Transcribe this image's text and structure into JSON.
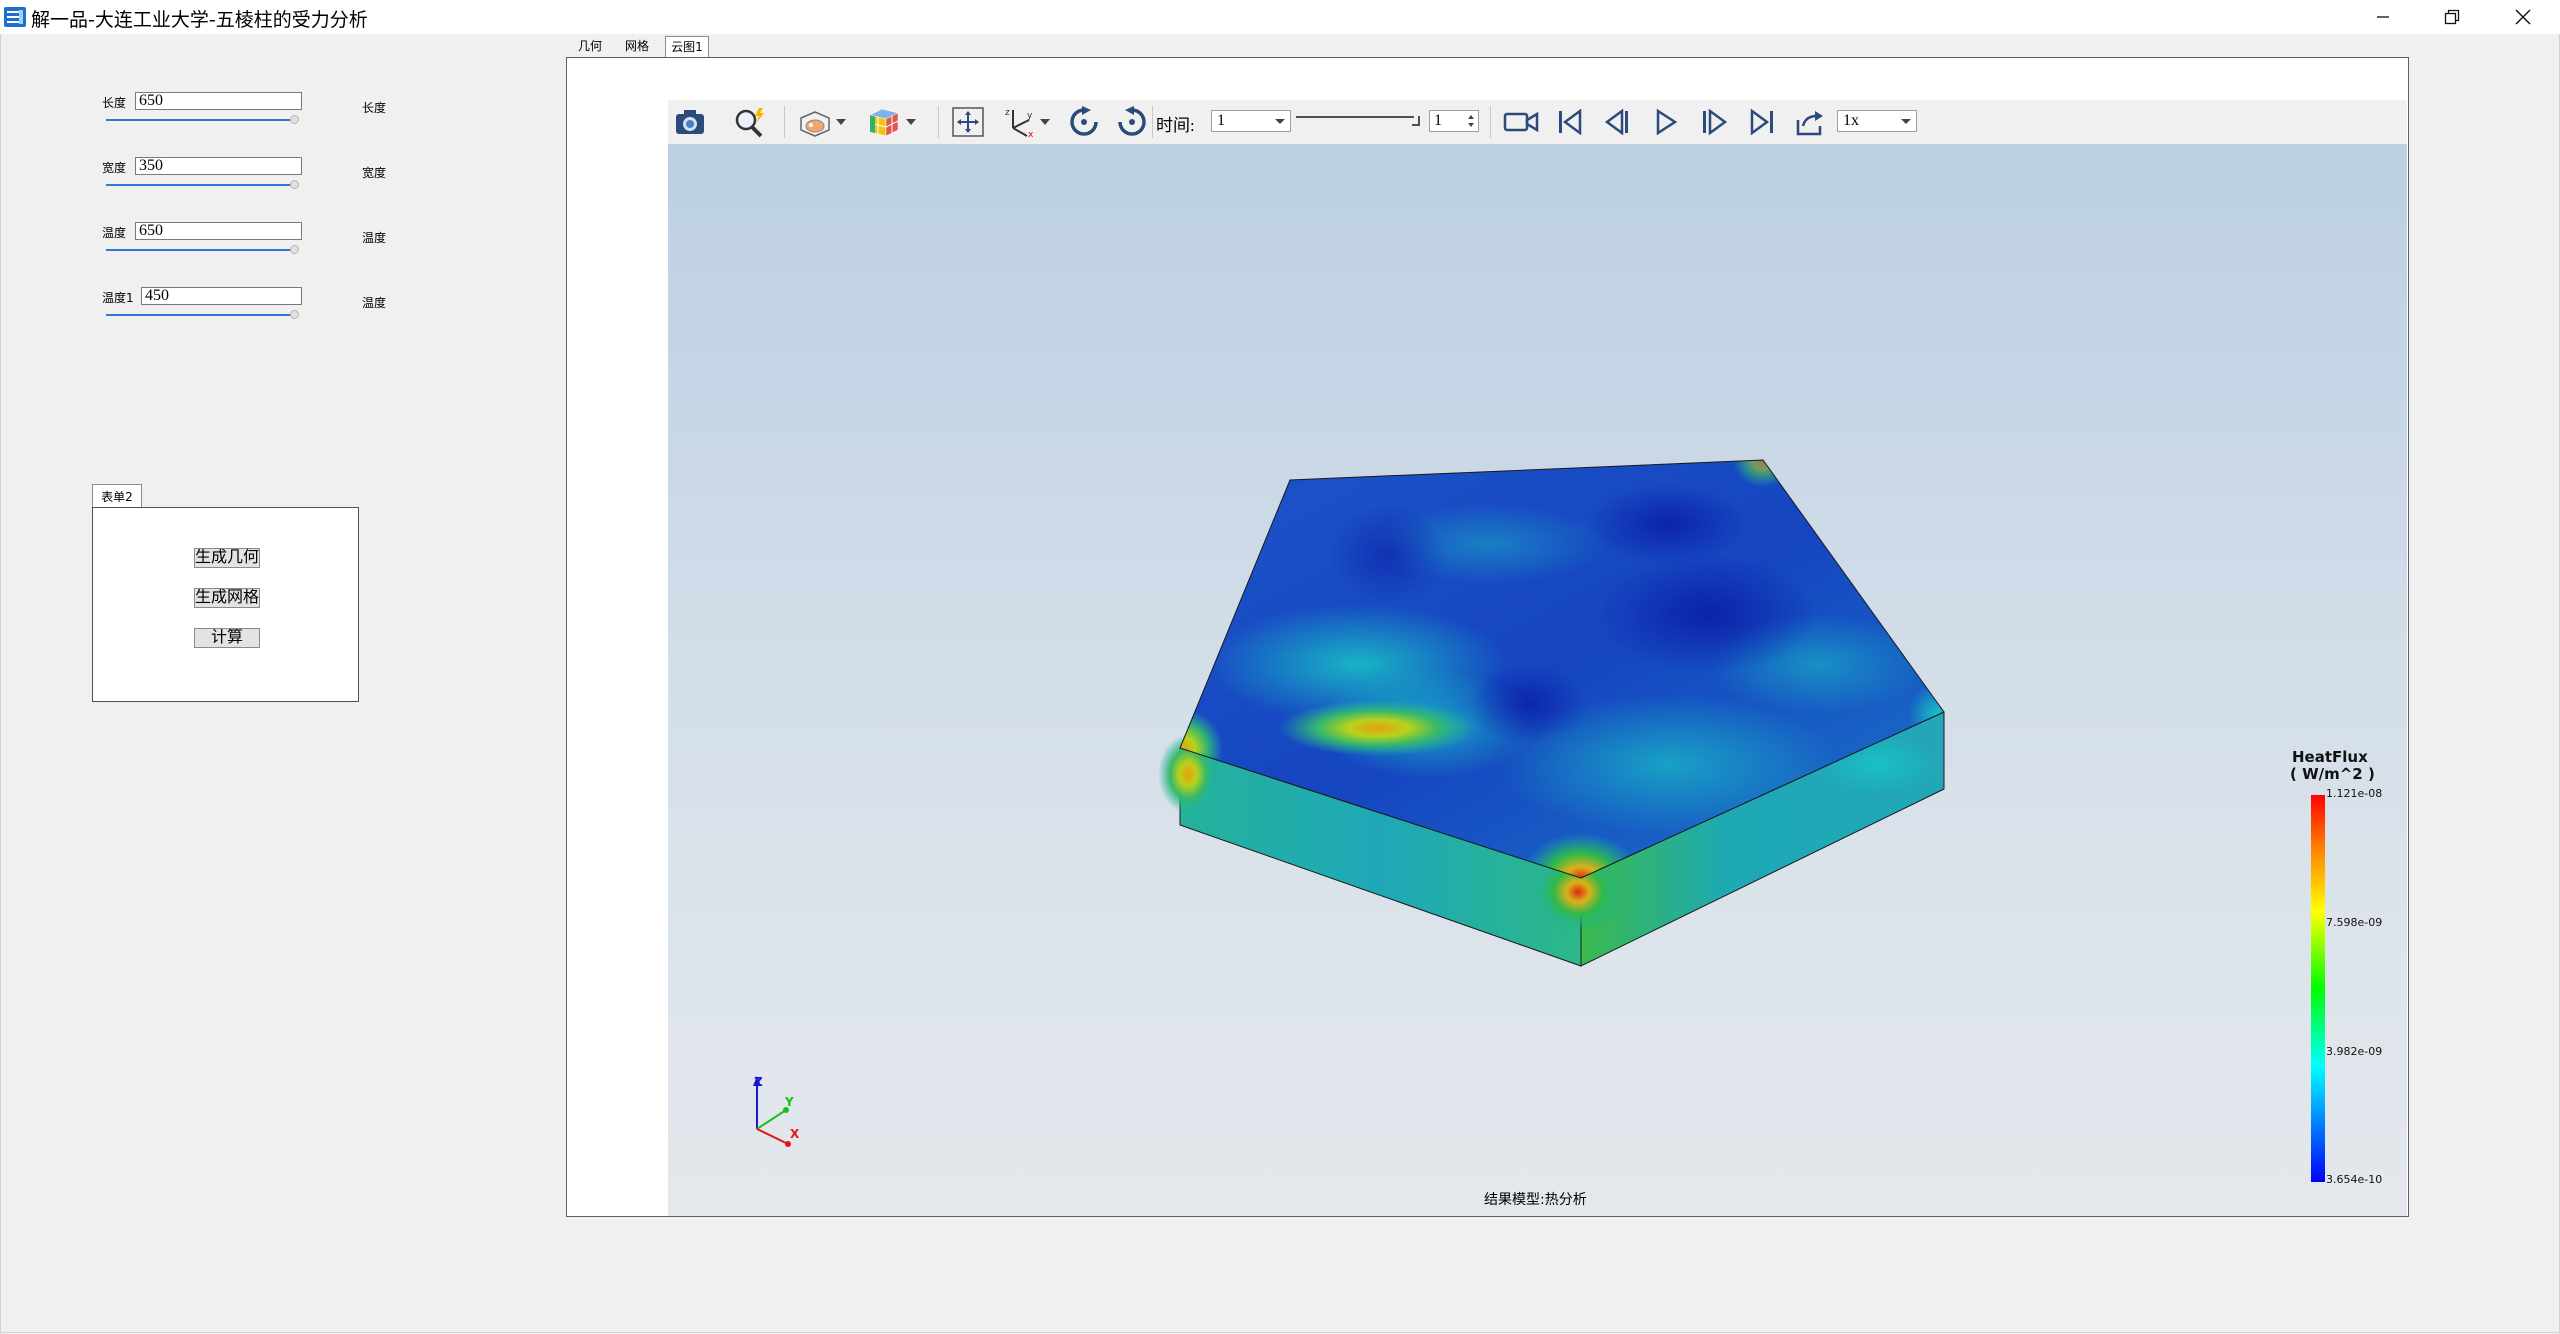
{
  "window": {
    "title": "解一品-大连工业大学-五棱柱的受力分析",
    "icons": [
      "app-icon",
      "minimize-icon",
      "restore-icon",
      "close-icon"
    ]
  },
  "parameters": [
    {
      "label": "长度",
      "value": "650",
      "unit": "长度",
      "slider_fraction": 1.0
    },
    {
      "label": "宽度",
      "value": "350",
      "unit": "宽度",
      "slider_fraction": 1.0
    },
    {
      "label": "温度",
      "value": "650",
      "unit": "温度",
      "slider_fraction": 1.0
    },
    {
      "label": "温度1",
      "value": "450",
      "unit": "温度",
      "slider_fraction": 1.0
    }
  ],
  "form": {
    "tab": "表单2",
    "buttons": [
      "生成几何",
      "生成网格",
      "计算"
    ]
  },
  "view_tabs": [
    {
      "label": "几何",
      "active": false
    },
    {
      "label": "网格",
      "active": false
    },
    {
      "label": "云图1",
      "active": true
    }
  ],
  "toolbar": {
    "icons": [
      "screenshot-camera-icon",
      "zoom-icon",
      "display-mode-icon",
      "color-cube-icon",
      "fit-view-icon",
      "axis-view-icon",
      "rotate-cw-icon",
      "rotate-ccw-icon",
      "record-video-icon",
      "first-frame-icon",
      "prev-frame-icon",
      "play-icon",
      "next-frame-icon",
      "last-frame-icon",
      "export-icon"
    ],
    "time_label": "时间:",
    "time_value": "1",
    "frame_value": "1",
    "speed": "1x"
  },
  "legend": {
    "title": "HeatFlux",
    "unit": "( W/m^2 )",
    "ticks": [
      "1.121e-08",
      "7.598e-09",
      "3.982e-09",
      "3.654e-10"
    ],
    "colors": {
      "max": "#ff0000",
      "mid_high": "#ffff00",
      "mid": "#00ff00",
      "mid_low": "#00ffff",
      "min": "#0000ff"
    }
  },
  "axes_triad": {
    "z": "Z",
    "y": "Y",
    "x": "X"
  },
  "caption": "结果模型:热分析"
}
